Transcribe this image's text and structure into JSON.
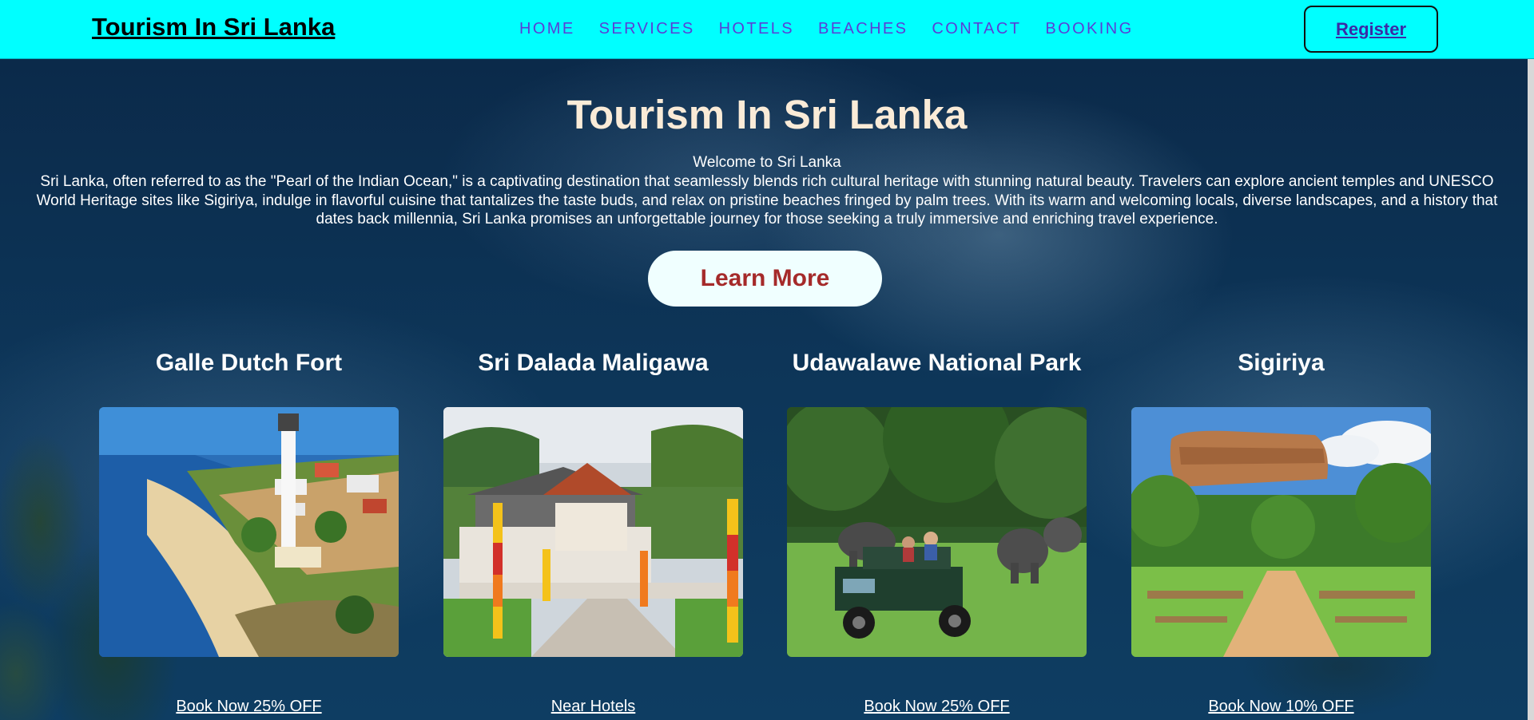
{
  "header": {
    "brand": "Tourism In Sri Lanka",
    "nav": [
      "HOME",
      "SERVICES",
      "HOTELS",
      "BEACHES",
      "CONTACT",
      "BOOKING"
    ],
    "register_label": "Register"
  },
  "hero": {
    "title": "Tourism In Sri Lanka",
    "subtitle": "Welcome to Sri Lanka",
    "text": "Sri Lanka, often referred to as the \"Pearl of the Indian Ocean,\" is a captivating destination that seamlessly blends rich cultural heritage with stunning natural beauty. Travelers can explore ancient temples and UNESCO World Heritage sites like Sigiriya, indulge in flavorful cuisine that tantalizes the taste buds, and relax on pristine beaches fringed by palm trees. With its warm and welcoming locals, diverse landscapes, and a history that dates back millennia, Sri Lanka promises an unforgettable journey for those seeking a truly immersive and enriching travel experience.",
    "learn_more_label": "Learn More"
  },
  "cards": [
    {
      "title": "Galle Dutch Fort",
      "link": "Book Now 25% OFF"
    },
    {
      "title": "Sri Dalada Maligawa",
      "link": "Near Hotels"
    },
    {
      "title": "Udawalawe National Park",
      "link": "Book Now 25% OFF"
    },
    {
      "title": "Sigiriya",
      "link": "Book Now 10% OFF"
    }
  ],
  "colors": {
    "header_bg": "#00ffff",
    "nav_link": "#5a3fd6",
    "hero_title": "#faebd7",
    "learn_more_text": "#a52a2a",
    "learn_more_bg": "#f0ffff"
  }
}
